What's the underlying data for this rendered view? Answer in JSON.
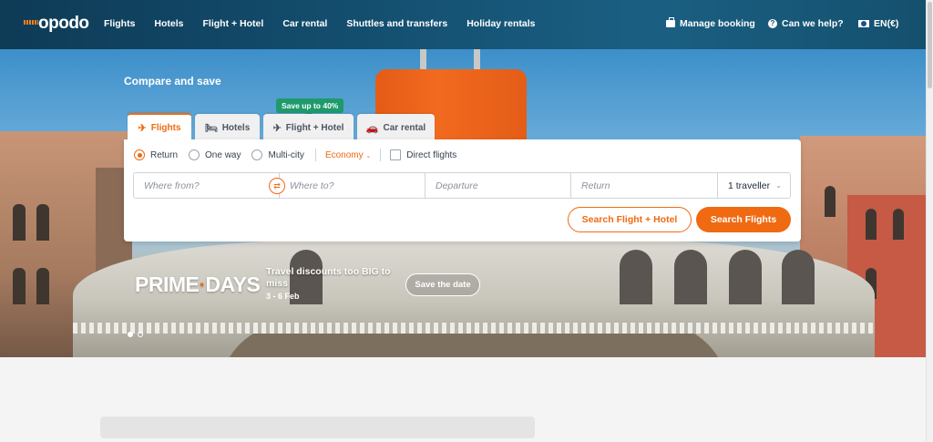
{
  "header": {
    "logo": "opodo",
    "nav": [
      "Flights",
      "Hotels",
      "Flight + Hotel",
      "Car rental",
      "Shuttles and transfers",
      "Holiday rentals"
    ],
    "manage_booking": "Manage booking",
    "help": "Can we help?",
    "language": "EN(€)"
  },
  "hero": {
    "headline": "Compare and save",
    "promo_badge": "Save up to 40%",
    "tabs": [
      {
        "label": "Flights",
        "icon": "plane-icon"
      },
      {
        "label": "Hotels",
        "icon": "bed-icon"
      },
      {
        "label": "Flight + Hotel",
        "icon": "plane-bed-icon"
      },
      {
        "label": "Car rental",
        "icon": "car-icon"
      }
    ],
    "active_tab": "Flights"
  },
  "search": {
    "trip_types": [
      "Return",
      "One way",
      "Multi-city"
    ],
    "selected_trip": "Return",
    "cabin_class": "Economy",
    "direct_flights": "Direct flights",
    "from_placeholder": "Where from?",
    "to_placeholder": "Where to?",
    "departure_placeholder": "Departure",
    "return_placeholder": "Return",
    "travellers": "1 traveller",
    "search_bundle": "Search Flight + Hotel",
    "search_flights": "Search Flights"
  },
  "banner": {
    "prime": "PRIME",
    "days": "DAYS",
    "tagline": "Travel discounts too BIG to miss",
    "dates": "3 - 6 Feb",
    "cta": "Save the date"
  },
  "colors": {
    "accent": "#f06a12",
    "header_bg": "#134c6c",
    "promo_green": "#1f9a6c"
  }
}
